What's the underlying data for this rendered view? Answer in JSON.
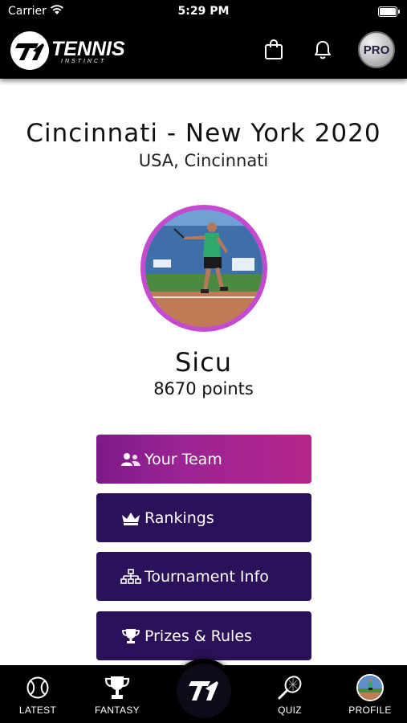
{
  "status_bar": {
    "carrier": "Carrier",
    "time": "5:29 PM"
  },
  "header": {
    "logo_text": "TENNIS",
    "logo_subtext": "INSTINCT",
    "icons": [
      "shopping-bag-icon",
      "bell-icon"
    ],
    "pro_badge": "PRO"
  },
  "tournament": {
    "title": "Cincinnati - New York 2020",
    "location": "USA, Cincinnati"
  },
  "player": {
    "name": "Sicu",
    "points": "8670 points"
  },
  "menu": {
    "your_team": "Your Team",
    "rankings": "Rankings",
    "tournament_info": "Tournament Info",
    "prizes_rules": "Prizes & Rules"
  },
  "tabs": {
    "latest": "LATEST",
    "fantasy": "FANTASY",
    "quiz": "QUIZ",
    "profile": "PROFILE"
  },
  "colors": {
    "accent_magenta": "#b5258a",
    "button_purple": "#2b1159",
    "avatar_ring": "#c44ad0"
  }
}
